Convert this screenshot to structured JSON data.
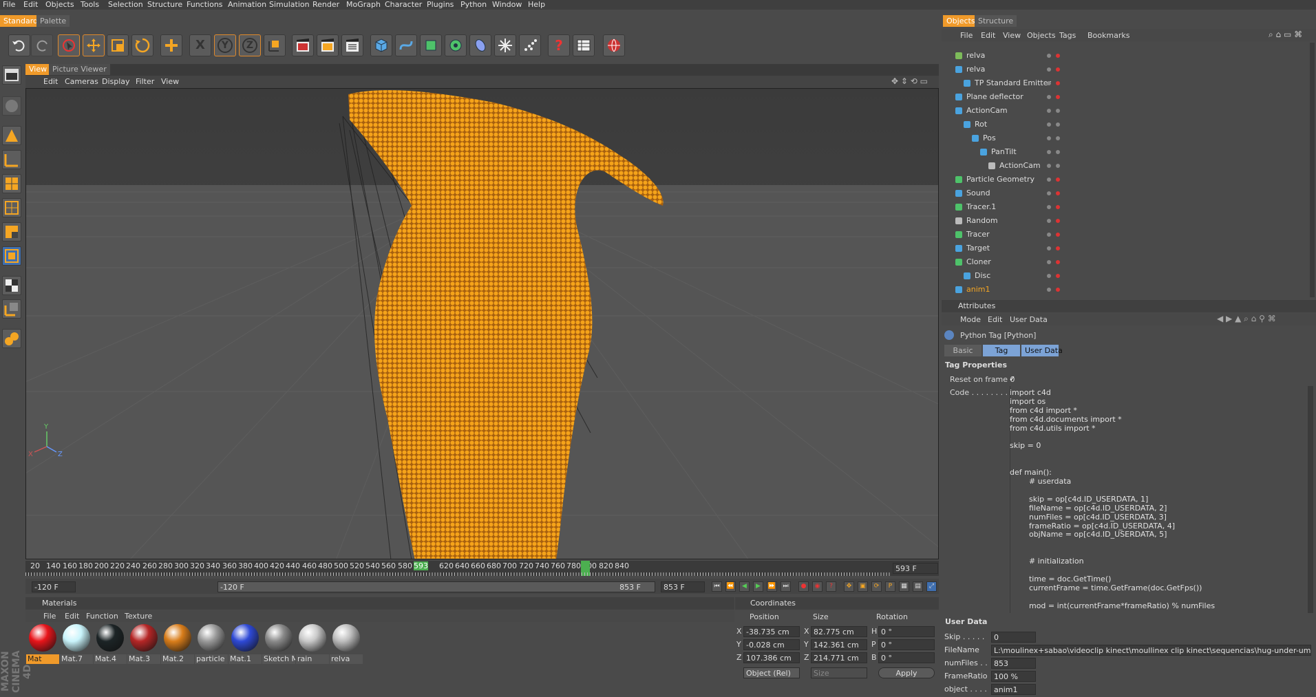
{
  "menu": [
    "File",
    "Edit",
    "Objects",
    "Tools",
    "Selection",
    "Structure",
    "Functions",
    "Animation",
    "Simulation",
    "Render",
    "MoGraph",
    "Character",
    "Plugins",
    "Python",
    "Window",
    "Help"
  ],
  "layout_tabs": {
    "standard": "Standard",
    "palette": "Palette"
  },
  "toolbar_icons": [
    "undo-icon",
    "redo-icon",
    "live-select-icon",
    "move-icon",
    "scale-icon",
    "rotate-icon",
    "add-icon",
    "x-axis-icon",
    "y-axis-icon",
    "z-axis-icon",
    "coordinate-system-icon",
    "render-view-icon",
    "render-picture-viewer-icon",
    "render-settings-icon",
    "cube-icon",
    "spline-icon",
    "nurbs-icon",
    "array-icon",
    "deformer-icon",
    "scene-icon",
    "particles-icon",
    "help-cursor-icon",
    "layer-manager-icon",
    "web-icon"
  ],
  "toolbar_labels": {
    "x": "X",
    "y": "Y",
    "z": "Z"
  },
  "viewport": {
    "tabs": {
      "view": "View",
      "picture_viewer": "Picture Viewer"
    },
    "menu": [
      "Edit",
      "Cameras",
      "Display",
      "Filter",
      "View"
    ],
    "axis": {
      "x": "X",
      "y": "Y",
      "z": "Z"
    }
  },
  "timeline": {
    "ticks": [
      "20",
      "140",
      "160",
      "180",
      "200",
      "220",
      "240",
      "260",
      "280",
      "300",
      "320",
      "340",
      "360",
      "380",
      "400",
      "420",
      "440",
      "460",
      "480",
      "500",
      "520",
      "540",
      "560",
      "580",
      "593",
      "620",
      "640",
      "660",
      "680",
      "700",
      "720",
      "740",
      "760",
      "780",
      "800",
      "820",
      "840"
    ],
    "current_frame": "593 F"
  },
  "transport": {
    "start": "-120 F",
    "range_start": "-120 F",
    "range_end": "853 F",
    "end": "853 F"
  },
  "materials": {
    "title": "Materials",
    "menu": [
      "File",
      "Edit",
      "Function",
      "Texture"
    ],
    "items": [
      {
        "name": "Mat",
        "color": "#e8141a",
        "selected": true
      },
      {
        "name": "Mat.7",
        "color": "#c9f4fb"
      },
      {
        "name": "Mat.4",
        "color": "#1c2426"
      },
      {
        "name": "Mat.3",
        "color": "#b52626"
      },
      {
        "name": "Mat.2",
        "color": "#d97d1a"
      },
      {
        "name": "particle p",
        "color": "#9a9a9a"
      },
      {
        "name": "Mat.1",
        "color": "#2e49d6"
      },
      {
        "name": "Sketch M",
        "color": "#8a8a8a"
      },
      {
        "name": "rain",
        "color": "#c8c8c8"
      },
      {
        "name": "relva",
        "color": "#bdbdbd"
      }
    ]
  },
  "coordinates": {
    "title": "Coordinates",
    "headers": {
      "position": "Position",
      "size": "Size",
      "rotation": "Rotation"
    },
    "rows": [
      {
        "axis": "X",
        "pos": "-38.735 cm",
        "size_axis": "X",
        "size": "82.775 cm",
        "rot_axis": "H",
        "rot": "0 °"
      },
      {
        "axis": "Y",
        "pos": "-0.028 cm",
        "size_axis": "Y",
        "size": "142.361 cm",
        "rot_axis": "P",
        "rot": "0 °"
      },
      {
        "axis": "Z",
        "pos": "107.386 cm",
        "size_axis": "Z",
        "size": "214.771 cm",
        "rot_axis": "B",
        "rot": "0 °"
      }
    ],
    "mode": "Object (Rel)",
    "size_mode": "Size",
    "apply": "Apply"
  },
  "objects_panel": {
    "tabs": {
      "objects": "Objects",
      "structure": "Structure"
    },
    "menu": [
      "File",
      "Edit",
      "View",
      "Objects",
      "Tags",
      "Bookmarks"
    ],
    "rows": [
      {
        "name": "relva",
        "indent": 0
      },
      {
        "name": "relva",
        "indent": 0
      },
      {
        "name": "TP Standard Emitter",
        "indent": 1
      },
      {
        "name": "Plane deflector",
        "indent": 0
      },
      {
        "name": "ActionCam",
        "indent": 0
      },
      {
        "name": "Rot",
        "indent": 1
      },
      {
        "name": "Pos",
        "indent": 2
      },
      {
        "name": "PanTilt",
        "indent": 3
      },
      {
        "name": "ActionCam",
        "indent": 4
      },
      {
        "name": "Particle Geometry",
        "indent": 0
      },
      {
        "name": "Sound",
        "indent": 0
      },
      {
        "name": "Tracer.1",
        "indent": 0
      },
      {
        "name": "Random",
        "indent": 0
      },
      {
        "name": "Tracer",
        "indent": 0
      },
      {
        "name": "Target",
        "indent": 0
      },
      {
        "name": "Cloner",
        "indent": 0
      },
      {
        "name": "Disc",
        "indent": 1
      },
      {
        "name": "anim1",
        "indent": 0,
        "active": true
      }
    ]
  },
  "attributes": {
    "title": "Attributes",
    "menu": [
      "Mode",
      "Edit",
      "User Data"
    ],
    "tag_title": "Python Tag [Python]",
    "tabs": [
      "Basic",
      "Tag",
      "User Data"
    ],
    "section": "Tag Properties",
    "reset_label": "Reset on frame 0",
    "reset_value": "✓",
    "code_label": "Code . . . . . . . . .",
    "code": [
      "import c4d",
      "import os",
      "from c4d import *",
      "from c4d.documents import *",
      "from c4d.utils import *",
      "",
      "skip = 0",
      "",
      "",
      "def main():",
      "        # userdata",
      "",
      "        skip = op[c4d.ID_USERDATA, 1]",
      "        fileName = op[c4d.ID_USERDATA, 2]",
      "        numFiles = op[c4d.ID_USERDATA, 3]",
      "        frameRatio = op[c4d.ID_USERDATA, 4]",
      "        objName = op[c4d.ID_USERDATA, 5]",
      "",
      "",
      "        # initialization",
      "",
      "        time = doc.GetTime()",
      "        currentFrame = time.GetFrame(doc.GetFps())",
      "",
      "        mod = int(currentFrame*frameRatio) % numFiles"
    ],
    "user_data_title": "User Data",
    "user_data": [
      {
        "label": "Skip . . . . .",
        "value": "0"
      },
      {
        "label": "FileName",
        "value": "L:\\moulinex+sabao\\videoclip kinect\\moullinex clip kinect\\sequencias\\hug-under-umbrella\\frame%"
      },
      {
        "label": "numFiles . .",
        "value": "853"
      },
      {
        "label": "FrameRatio",
        "value": "100 %"
      },
      {
        "label": "object . . . .",
        "value": "anim1"
      }
    ]
  },
  "brand": "MAXON CINEMA 4D"
}
